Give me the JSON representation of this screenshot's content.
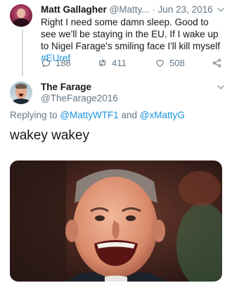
{
  "tweet1": {
    "name": "Matt Gallagher",
    "handle": "@Matty...",
    "separator": "·",
    "date": "Jun 23, 2016",
    "text_before_hashtag": "Right I need some damn sleep. Good to see we'll be staying in the EU. If I wake up to Nigel Farage's smiling face I'll kill myself ",
    "hashtag": "#EUref",
    "reply_count": "188",
    "retweet_count": "411",
    "like_count": "508",
    "icons": [
      "reply-icon",
      "retweet-icon",
      "like-icon",
      "share-icon",
      "chevron-down-icon"
    ]
  },
  "tweet2": {
    "name": "The Farage",
    "handle": "@TheFarage2016",
    "replying_prefix": "Replying to ",
    "mention1": "@MattyWTF1",
    "conjunction": " and ",
    "mention2": "@xMattyG",
    "text": "wakey wakey"
  },
  "colors": {
    "link": "#1b95e0",
    "secondary_text": "#657786",
    "primary_text": "#14171a"
  }
}
